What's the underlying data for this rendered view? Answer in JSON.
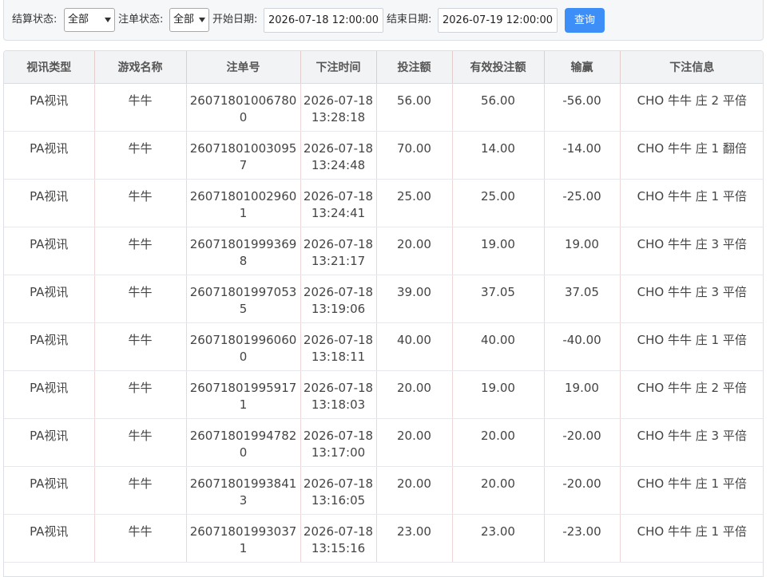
{
  "filters": {
    "settle_label": "结算状态:",
    "settle_value": "全部",
    "bet_status_label": "注单状态:",
    "bet_status_value": "全部",
    "start_label": "开始日期:",
    "start_value": "2026-07-18 12:00:00",
    "end_label": "结束日期:",
    "end_value": "2026-07-19 12:00:00",
    "query_label": "查询"
  },
  "table": {
    "headers": [
      "视讯类型",
      "游戏名称",
      "注单号",
      "下注时间",
      "投注额",
      "有效投注额",
      "输赢",
      "下注信息"
    ],
    "rows": [
      {
        "type": "PA视讯",
        "game": "牛牛",
        "bet_no": "260718010067800",
        "date": "2026-07-18",
        "time": "13:28:18",
        "amount": "56.00",
        "valid": "56.00",
        "win_loss": "-56.00",
        "info": "CHO 牛牛 庄 2 平倍"
      },
      {
        "type": "PA视讯",
        "game": "牛牛",
        "bet_no": "260718010030957",
        "date": "2026-07-18",
        "time": "13:24:48",
        "amount": "70.00",
        "valid": "14.00",
        "win_loss": "-14.00",
        "info": "CHO 牛牛 庄 1 翻倍"
      },
      {
        "type": "PA视讯",
        "game": "牛牛",
        "bet_no": "260718010029601",
        "date": "2026-07-18",
        "time": "13:24:41",
        "amount": "25.00",
        "valid": "25.00",
        "win_loss": "-25.00",
        "info": "CHO 牛牛 庄 1 平倍"
      },
      {
        "type": "PA视讯",
        "game": "牛牛",
        "bet_no": "260718019993698",
        "date": "2026-07-18",
        "time": "13:21:17",
        "amount": "20.00",
        "valid": "19.00",
        "win_loss": "19.00",
        "info": "CHO 牛牛 庄 3 平倍"
      },
      {
        "type": "PA视讯",
        "game": "牛牛",
        "bet_no": "260718019970535",
        "date": "2026-07-18",
        "time": "13:19:06",
        "amount": "39.00",
        "valid": "37.05",
        "win_loss": "37.05",
        "info": "CHO 牛牛 庄 3 平倍"
      },
      {
        "type": "PA视讯",
        "game": "牛牛",
        "bet_no": "260718019960600",
        "date": "2026-07-18",
        "time": "13:18:11",
        "amount": "40.00",
        "valid": "40.00",
        "win_loss": "-40.00",
        "info": "CHO 牛牛 庄 1 平倍"
      },
      {
        "type": "PA视讯",
        "game": "牛牛",
        "bet_no": "260718019959171",
        "date": "2026-07-18",
        "time": "13:18:03",
        "amount": "20.00",
        "valid": "19.00",
        "win_loss": "19.00",
        "info": "CHO 牛牛 庄 2 平倍"
      },
      {
        "type": "PA视讯",
        "game": "牛牛",
        "bet_no": "260718019947820",
        "date": "2026-07-18",
        "time": "13:17:00",
        "amount": "20.00",
        "valid": "20.00",
        "win_loss": "-20.00",
        "info": "CHO 牛牛 庄 3 平倍"
      },
      {
        "type": "PA视讯",
        "game": "牛牛",
        "bet_no": "260718019938413",
        "date": "2026-07-18",
        "time": "13:16:05",
        "amount": "20.00",
        "valid": "20.00",
        "win_loss": "-20.00",
        "info": "CHO 牛牛 庄 1 平倍"
      },
      {
        "type": "PA视讯",
        "game": "牛牛",
        "bet_no": "260718019930371",
        "date": "2026-07-18",
        "time": "13:15:16",
        "amount": "23.00",
        "valid": "23.00",
        "win_loss": "-23.00",
        "info": "CHO 牛牛 庄 1 平倍"
      }
    ]
  }
}
